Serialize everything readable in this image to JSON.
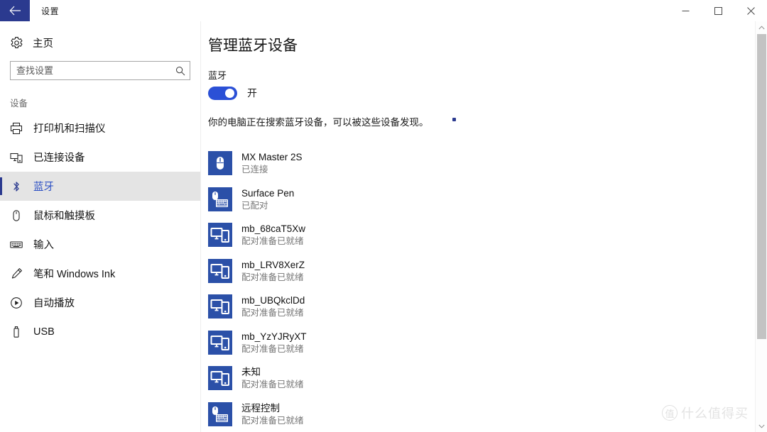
{
  "window": {
    "app_title": "设置",
    "back_icon": "back-arrow-icon",
    "minimize_label": "─",
    "maximize_label": "□",
    "close_label": "✕"
  },
  "sidebar": {
    "home": {
      "label": "主页",
      "icon": "gear-icon"
    },
    "search": {
      "placeholder": "查找设置",
      "value": "",
      "icon": "search-icon"
    },
    "section_label": "设备",
    "items": [
      {
        "label": "打印机和扫描仪",
        "icon": "printer-icon",
        "selected": false
      },
      {
        "label": "已连接设备",
        "icon": "connected-devices-icon",
        "selected": false
      },
      {
        "label": "蓝牙",
        "icon": "bluetooth-icon",
        "selected": true
      },
      {
        "label": "鼠标和触摸板",
        "icon": "mouse-icon",
        "selected": false
      },
      {
        "label": "输入",
        "icon": "keyboard-icon",
        "selected": false
      },
      {
        "label": "笔和 Windows Ink",
        "icon": "pen-icon",
        "selected": false
      },
      {
        "label": "自动播放",
        "icon": "autoplay-icon",
        "selected": false
      },
      {
        "label": "USB",
        "icon": "usb-icon",
        "selected": false
      }
    ]
  },
  "main": {
    "page_title": "管理蓝牙设备",
    "toggle_label": "蓝牙",
    "toggle_state": "开",
    "toggle_on": true,
    "description": "你的电脑正在搜索蓝牙设备，可以被这些设备发现。",
    "busy_indicator": "searching-dot",
    "devices": [
      {
        "name": "MX Master 2S",
        "status": "已连接",
        "icon": "mouse-device-icon"
      },
      {
        "name": "Surface Pen",
        "status": "已配对",
        "icon": "mouse-keyboard-device-icon"
      },
      {
        "name": "mb_68caT5Xw",
        "status": "配对准备已就绪",
        "icon": "monitor-phone-device-icon"
      },
      {
        "name": "mb_LRV8XerZ",
        "status": "配对准备已就绪",
        "icon": "monitor-phone-device-icon"
      },
      {
        "name": "mb_UBQkclDd",
        "status": "配对准备已就绪",
        "icon": "monitor-phone-device-icon"
      },
      {
        "name": "mb_YzYJRyXT",
        "status": "配对准备已就绪",
        "icon": "monitor-phone-device-icon"
      },
      {
        "name": "未知",
        "status": "配对准备已就绪",
        "icon": "monitor-phone-device-icon"
      },
      {
        "name": "远程控制",
        "status": "配对准备已就绪",
        "icon": "mouse-keyboard-device-icon"
      }
    ]
  },
  "scrollbar": {
    "up_arrow": "∧",
    "down_arrow": "∨"
  },
  "watermark": {
    "badge": "值",
    "text": "什么值得买"
  },
  "colors": {
    "accent_blue": "#2b3a8f",
    "toggle_blue": "#2b50d6",
    "device_tile_blue": "#2b50a8",
    "selected_text_blue": "#2b4fc4",
    "status_gray": "#767676"
  }
}
